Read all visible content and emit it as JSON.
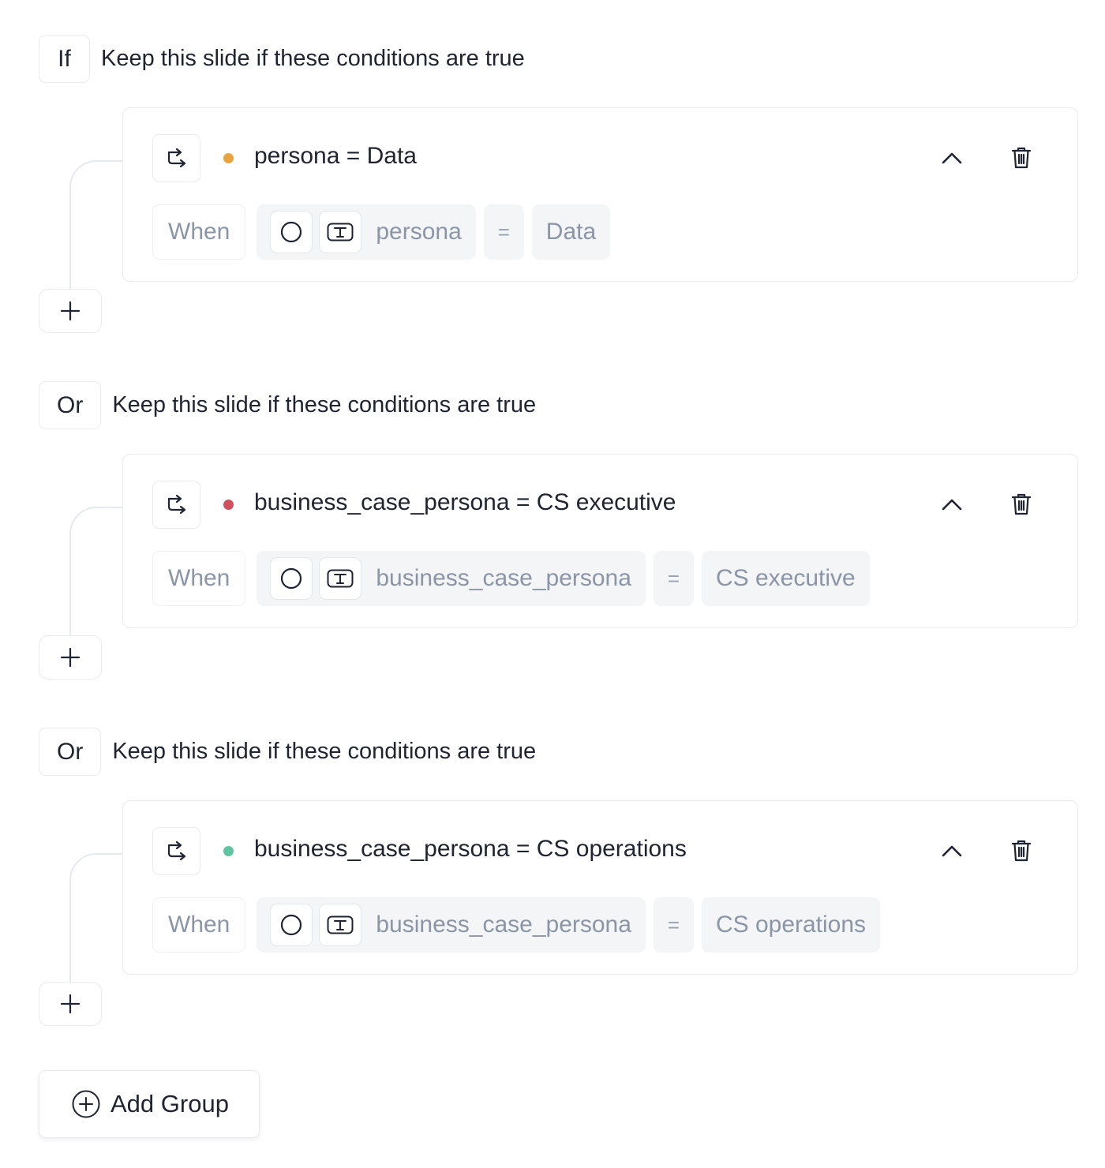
{
  "groups": [
    {
      "logic": "If",
      "description": "Keep this slide if these conditions are true",
      "condition": {
        "title": "persona = Data",
        "status_color": "#e8a23f",
        "when_label": "When",
        "field": "persona",
        "operator": "=",
        "value": "Data"
      }
    },
    {
      "logic": "Or",
      "description": "Keep this slide if these conditions are true",
      "condition": {
        "title": "business_case_persona = CS executive",
        "status_color": "#d24f5e",
        "when_label": "When",
        "field": "business_case_persona",
        "operator": "=",
        "value": "CS executive"
      }
    },
    {
      "logic": "Or",
      "description": "Keep this slide if these conditions are true",
      "condition": {
        "title": "business_case_persona = CS operations",
        "status_color": "#5fc4a0",
        "when_label": "When",
        "field": "business_case_persona",
        "operator": "=",
        "value": "CS operations"
      }
    }
  ],
  "icons": {
    "branch": "branch-arrow-icon",
    "circle": "circle-icon",
    "text_type": "text-type-icon",
    "collapse": "chevron-up-icon",
    "delete": "trash-icon",
    "add": "plus-icon",
    "add_group": "plus-circle-icon"
  },
  "add_group_label": "Add Group"
}
